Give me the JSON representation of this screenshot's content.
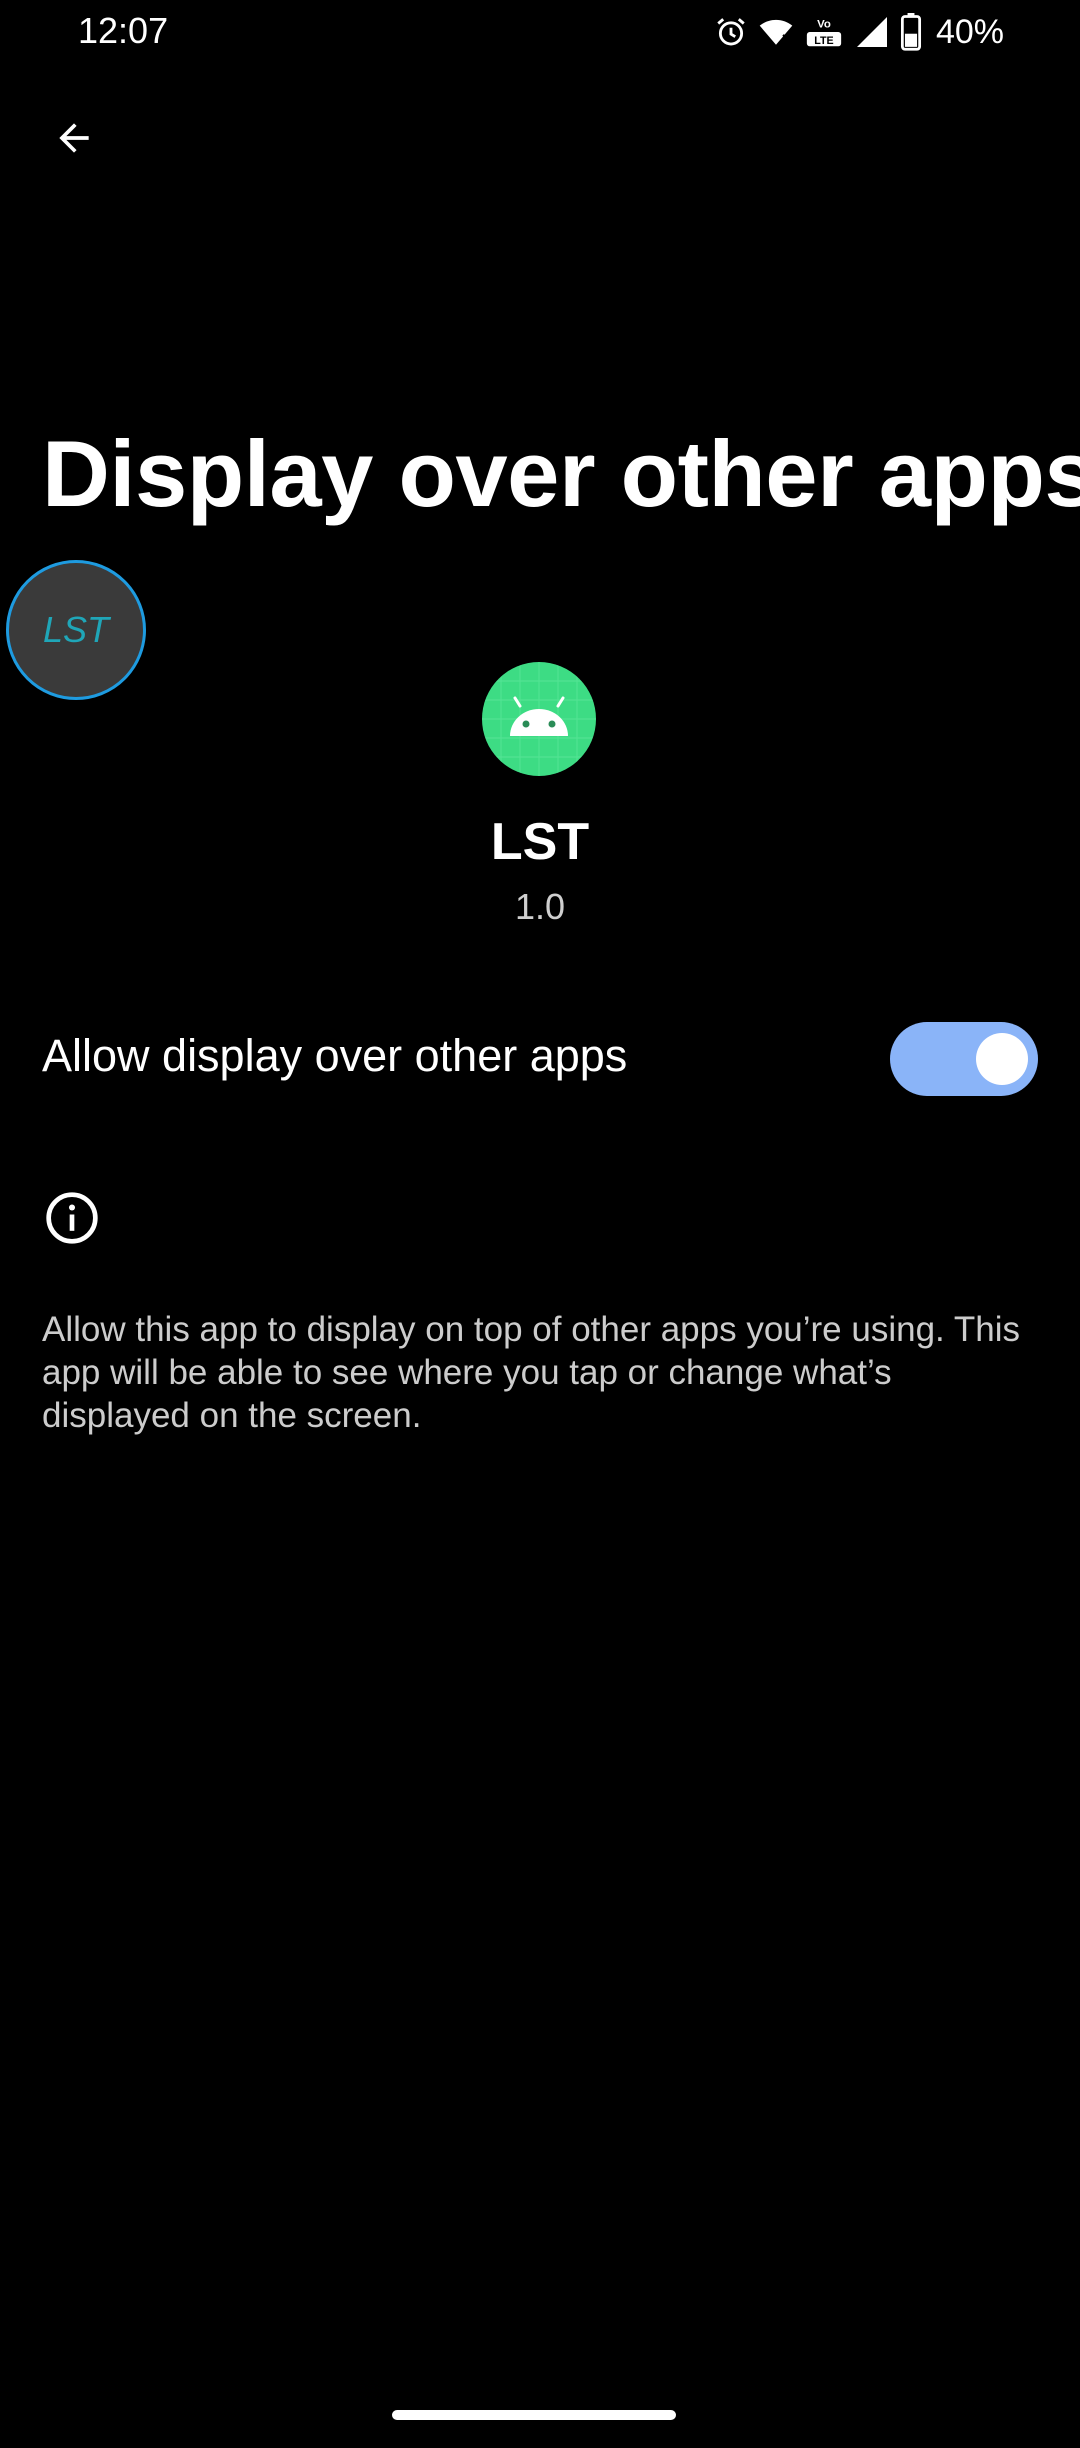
{
  "status_bar": {
    "time": "12:07",
    "battery": "40%",
    "volte": "LTE",
    "icons": [
      "alarm-icon",
      "wifi-icon",
      "volte-icon",
      "signal-icon",
      "battery-icon"
    ]
  },
  "header": {
    "back_icon": "arrow-back-icon",
    "title": "Display over other apps"
  },
  "overlay_bubble": {
    "label": "LST",
    "border_color": "#1e9be0",
    "text_color": "#1fa6b8"
  },
  "app": {
    "icon": "android-icon",
    "icon_color": "#3ddc84",
    "name": "LST",
    "version": "1.0"
  },
  "permission": {
    "label": "Allow display over other apps",
    "enabled": true,
    "accent_color": "#8ab4f8"
  },
  "info": {
    "icon": "info-icon",
    "text": "Allow this app to display on top of other apps you’re using. This app will be able to see where you tap or change what’s displayed on the screen."
  }
}
